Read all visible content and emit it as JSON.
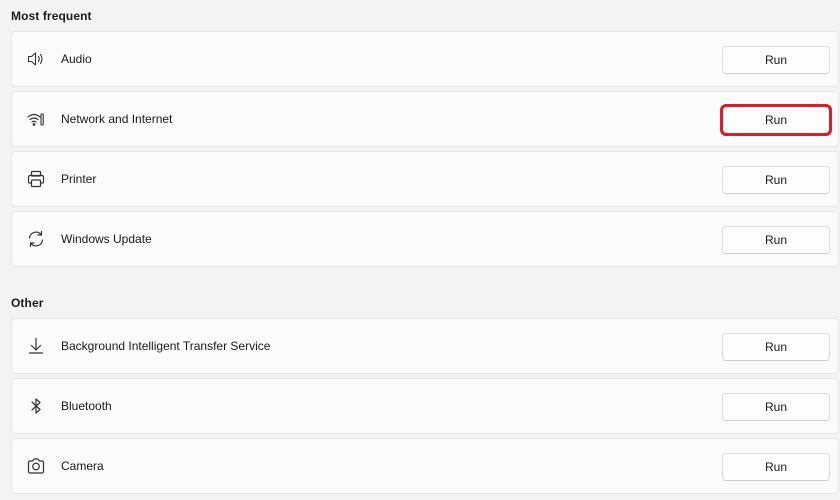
{
  "sections": [
    {
      "title": "Most frequent",
      "items": [
        {
          "label": "Audio",
          "icon": "speaker-icon",
          "button": "Run"
        },
        {
          "label": "Network and Internet",
          "icon": "wifi-network-icon",
          "button": "Run",
          "highlighted": true
        },
        {
          "label": "Printer",
          "icon": "printer-icon",
          "button": "Run"
        },
        {
          "label": "Windows Update",
          "icon": "sync-icon",
          "button": "Run"
        }
      ]
    },
    {
      "title": "Other",
      "items": [
        {
          "label": "Background Intelligent Transfer Service",
          "icon": "download-icon",
          "button": "Run"
        },
        {
          "label": "Bluetooth",
          "icon": "bluetooth-icon",
          "button": "Run"
        },
        {
          "label": "Camera",
          "icon": "camera-icon",
          "button": "Run"
        }
      ]
    }
  ],
  "colors": {
    "background": "#f3f3f3",
    "card": "#fbfbfb",
    "highlight": "#d81e2c"
  }
}
